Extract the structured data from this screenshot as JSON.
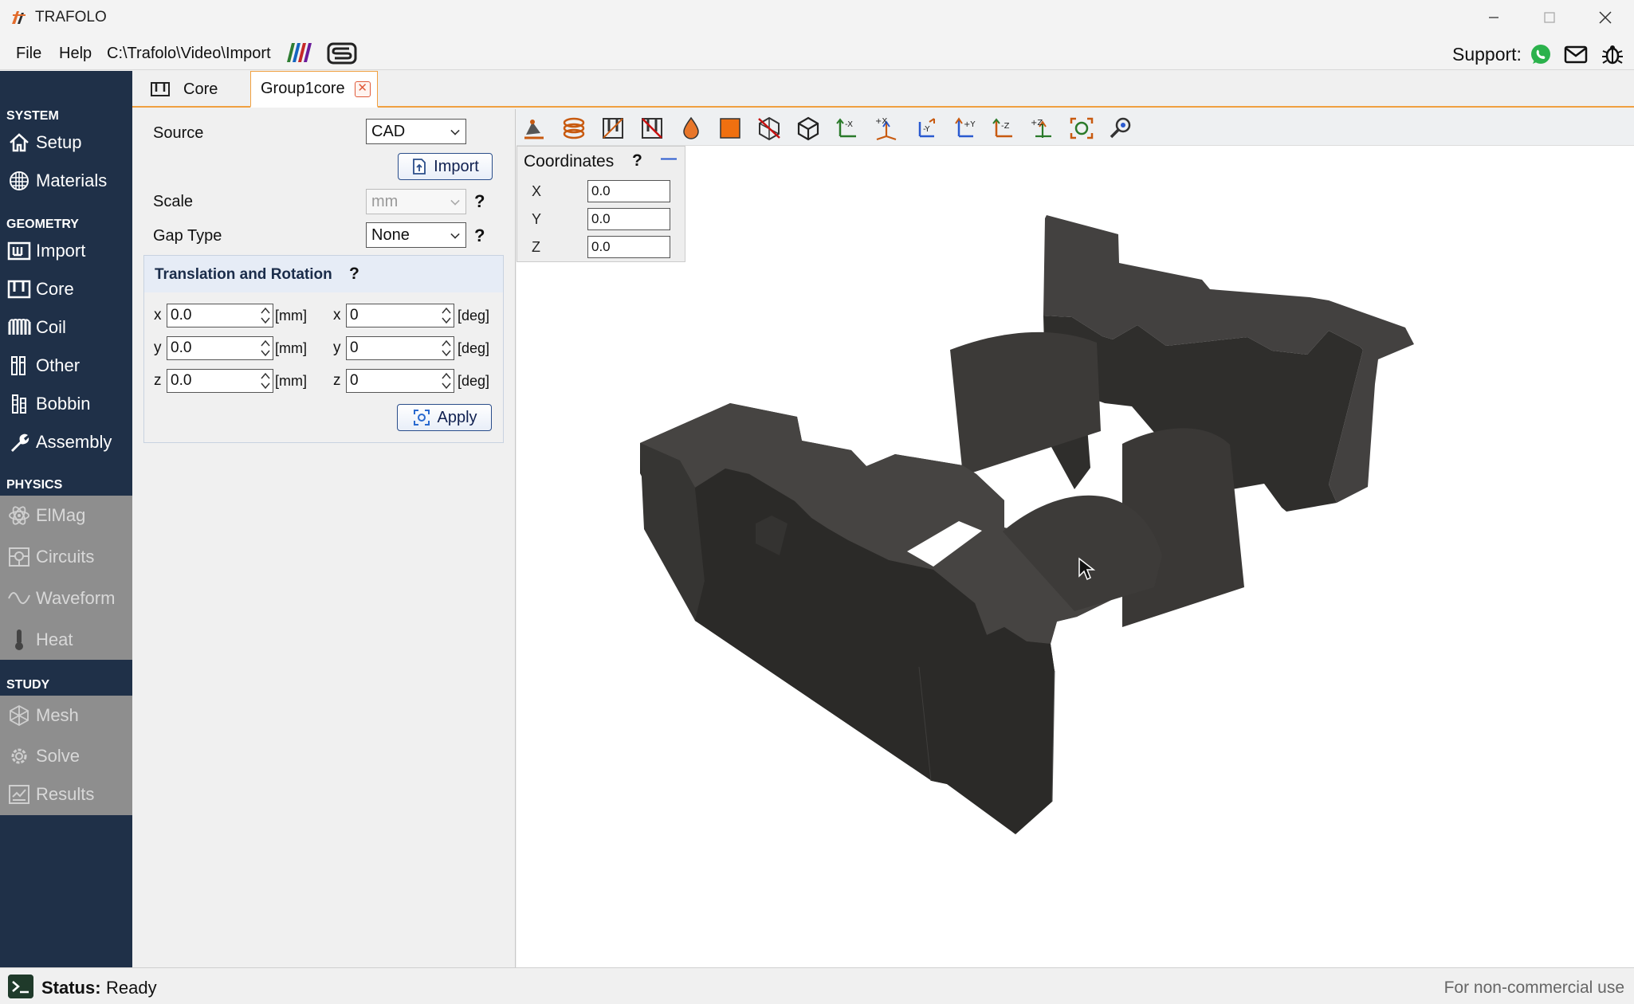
{
  "window": {
    "title": "TRAFOLO"
  },
  "menu": {
    "file": "File",
    "help": "Help",
    "path": "C:\\Trafolo\\Video\\Import",
    "support_label": "Support:"
  },
  "sidebar": {
    "system": "SYSTEM",
    "setup": "Setup",
    "materials": "Materials",
    "geometry": "GEOMETRY",
    "import": "Import",
    "core": "Core",
    "coil": "Coil",
    "other": "Other",
    "bobbin": "Bobbin",
    "assembly": "Assembly",
    "physics": "PHYSICS",
    "elmag": "ElMag",
    "circuits": "Circuits",
    "waveform": "Waveform",
    "heat": "Heat",
    "study": "STUDY",
    "mesh": "Mesh",
    "solve": "Solve",
    "results": "Results"
  },
  "tabs": [
    {
      "label": "Core"
    },
    {
      "label": "Group1core"
    }
  ],
  "panel": {
    "source_label": "Source",
    "source_value": "CAD",
    "import_button": "Import",
    "scale_label": "Scale",
    "scale_value": "mm",
    "gap_type_label": "Gap Type",
    "gap_type_value": "None",
    "help_mark": "?",
    "group_title": "Translation and Rotation",
    "translation": {
      "x_label": "x",
      "x_value": "0.0",
      "y_label": "y",
      "y_value": "0.0",
      "z_label": "z",
      "z_value": "0.0",
      "unit": "[mm]"
    },
    "rotation": {
      "x_label": "x",
      "x_value": "0",
      "y_label": "y",
      "y_value": "0",
      "z_label": "z",
      "z_value": "0",
      "unit": "[deg]"
    },
    "apply_button": "Apply"
  },
  "coordinates": {
    "title": "Coordinates",
    "help": "?",
    "collapse": "—",
    "x_label": "X",
    "x_value": "0.0",
    "y_label": "Y",
    "y_value": "0.0",
    "z_label": "Z",
    "z_value": "0.0"
  },
  "status": {
    "label": "Status:",
    "value": "Ready",
    "license": "For non-commercial use"
  },
  "colors": {
    "sidebar_bg": "#1f3048",
    "accent": "#f0a040",
    "core_fill": "#3a3836"
  }
}
